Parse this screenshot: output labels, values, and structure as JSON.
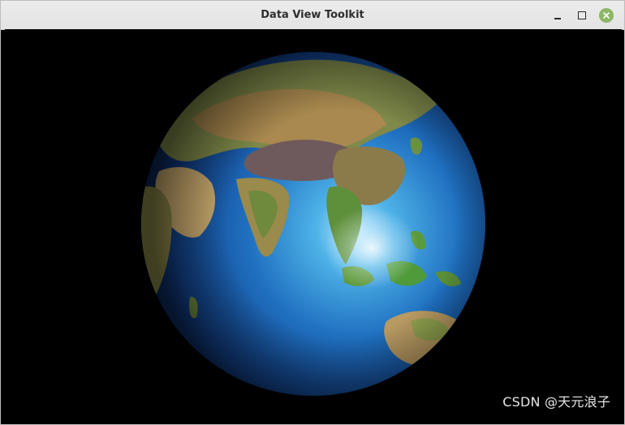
{
  "window": {
    "title": "Data View Toolkit",
    "controls": {
      "minimize": "minimize-icon",
      "maximize": "maximize-icon",
      "close": "close-icon"
    },
    "close_color": "#8db665"
  },
  "viewport": {
    "background": "#000000",
    "scene": "earth-globe",
    "watermark": "CSDN @天元浪子"
  }
}
